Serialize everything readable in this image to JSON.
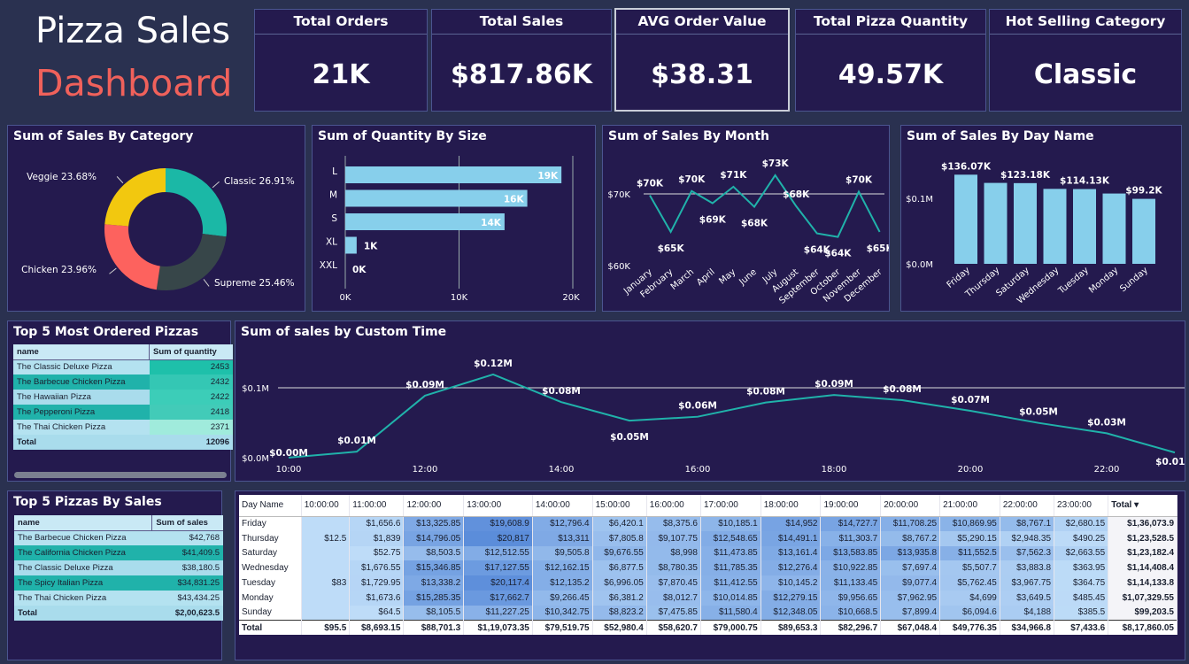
{
  "header": {
    "title_line1": "Pizza Sales",
    "title_line2": "Dashboard"
  },
  "kpis": [
    {
      "label": "Total Orders",
      "value": "21K"
    },
    {
      "label": "Total Sales",
      "value": "$817.86K"
    },
    {
      "label": "AVG Order Value",
      "value": "$38.31"
    },
    {
      "label": "Total Pizza Quantity",
      "value": "49.57K"
    },
    {
      "label": "Hot Selling Category",
      "value": "Classic"
    }
  ],
  "colors": {
    "background": "#2a3150",
    "card": "#241a4e",
    "accent_teal": "#20b2aa",
    "bar_blue": "#87ceeb",
    "red": "#f0615b"
  },
  "chart_data": [
    {
      "type": "pie",
      "title": "Sum of Sales By Category",
      "slices": [
        {
          "name": "Classic",
          "value": 26.91,
          "label": "Classic 26.91%",
          "color": "#1bb8a6"
        },
        {
          "name": "Supreme",
          "value": 25.46,
          "label": "Supreme 25.46%",
          "color": "#374649"
        },
        {
          "name": "Chicken",
          "value": 23.96,
          "label": "Chicken 23.96%",
          "color": "#fd625e"
        },
        {
          "name": "Veggie",
          "value": 23.68,
          "label": "Veggie 23.68%",
          "color": "#f2c80f"
        }
      ]
    },
    {
      "type": "bar",
      "title": "Sum of Quantity By Size",
      "orientation": "horizontal",
      "categories": [
        "L",
        "M",
        "S",
        "XL",
        "XXL"
      ],
      "values": [
        19000,
        16000,
        14000,
        1000,
        0
      ],
      "data_labels": [
        "19K",
        "16K",
        "14K",
        "1K",
        "0K"
      ],
      "ticks": [
        "0K",
        "10K",
        "20K"
      ],
      "xlim": [
        0,
        20000
      ]
    },
    {
      "type": "line",
      "title": "Sum of Sales By Month",
      "categories": [
        "January",
        "February",
        "March",
        "April",
        "May",
        "June",
        "July",
        "August",
        "September",
        "October",
        "November",
        "December"
      ],
      "values": [
        69800,
        64700,
        70400,
        68700,
        71000,
        68200,
        72600,
        68300,
        64500,
        64000,
        70300,
        64700
      ],
      "data_labels": [
        "$70K",
        "$65K",
        "$70K",
        "$69K",
        "$71K",
        "$68K",
        "$73K",
        "$68K",
        "$64K",
        "$64K",
        "$70K",
        "$65K"
      ],
      "yticks": [
        "$60K",
        "$70K"
      ],
      "ylim": [
        60000,
        72500
      ]
    },
    {
      "type": "bar",
      "title": "Sum of Sales By Day Name",
      "categories": [
        "Friday",
        "Thursday",
        "Saturday",
        "Wednesday",
        "Tuesday",
        "Monday",
        "Sunday"
      ],
      "values": [
        136070,
        123530,
        123180,
        114410,
        114130,
        107330,
        99200
      ],
      "data_labels": [
        "$136.07K",
        "",
        "$123.18K",
        "",
        "$114.13K",
        "",
        "$99.2K"
      ],
      "yticks": [
        "$0.0M",
        "$0.1M"
      ],
      "ylim": [
        0,
        150000
      ]
    },
    {
      "type": "line",
      "title": "Sum of sales by Custom Time",
      "x": [
        10,
        11,
        12,
        13,
        14,
        15,
        16,
        17,
        18,
        19,
        20,
        21,
        22,
        23
      ],
      "values": [
        95.5,
        8693.15,
        88701.3,
        119073.35,
        79519.75,
        52980.4,
        58620.7,
        79000.75,
        89653.3,
        82296.7,
        67048.4,
        49776.35,
        34966.8,
        7433.6
      ],
      "data_labels": [
        "$0.00M",
        "$0.01M",
        "$0.09M",
        "$0.12M",
        "$0.08M",
        "$0.05M",
        "$0.06M",
        "$0.08M",
        "$0.09M",
        "$0.08M",
        "$0.07M",
        "$0.05M",
        "$0.03M",
        "$0.01M"
      ],
      "xticks": [
        "10:00",
        "12:00",
        "14:00",
        "16:00",
        "18:00",
        "20:00",
        "22:00"
      ],
      "yticks": [
        "$0.0M",
        "$0.1M"
      ],
      "ylim": [
        0,
        130000
      ]
    }
  ],
  "top5_quantity": {
    "title": "Top 5 Most Ordered Pizzas",
    "headers": [
      "name",
      "Sum of quantity"
    ],
    "rows": [
      [
        "The Classic Deluxe Pizza",
        "2453"
      ],
      [
        "The Barbecue Chicken Pizza",
        "2432"
      ],
      [
        "The Hawaiian Pizza",
        "2422"
      ],
      [
        "The Pepperoni Pizza",
        "2418"
      ],
      [
        "The Thai Chicken Pizza",
        "2371"
      ]
    ],
    "total": [
      "Total",
      "12096"
    ]
  },
  "top5_sales": {
    "title": "Top 5 Pizzas By Sales",
    "headers": [
      "name",
      "Sum of sales"
    ],
    "rows": [
      [
        "The Barbecue Chicken Pizza",
        "$42,768"
      ],
      [
        "The California Chicken Pizza",
        "$41,409.5"
      ],
      [
        "The Classic Deluxe Pizza",
        "$38,180.5"
      ],
      [
        "The Spicy Italian Pizza",
        "$34,831.25"
      ],
      [
        "The Thai Chicken Pizza",
        "$43,434.25"
      ]
    ],
    "total": [
      "Total",
      "$2,00,623.5"
    ]
  },
  "matrix": {
    "headers": [
      "Day Name",
      "10:00:00",
      "11:00:00",
      "12:00:00",
      "13:00:00",
      "14:00:00",
      "15:00:00",
      "16:00:00",
      "17:00:00",
      "18:00:00",
      "19:00:00",
      "20:00:00",
      "21:00:00",
      "22:00:00",
      "23:00:00",
      "Total"
    ],
    "rows": [
      [
        "Friday",
        "",
        "$1,656.6",
        "$13,325.85",
        "$19,608.9",
        "$12,796.4",
        "$6,420.1",
        "$8,375.6",
        "$10,185.1",
        "$14,952",
        "$14,727.7",
        "$11,708.25",
        "$10,869.95",
        "$8,767.1",
        "$2,680.15",
        "$1,36,073.9"
      ],
      [
        "Thursday",
        "$12.5",
        "$1,839",
        "$14,796.05",
        "$20,817",
        "$13,311",
        "$7,805.8",
        "$9,107.75",
        "$12,548.65",
        "$14,491.1",
        "$11,303.7",
        "$8,767.2",
        "$5,290.15",
        "$2,948.35",
        "$490.25",
        "$1,23,528.5"
      ],
      [
        "Saturday",
        "",
        "$52.75",
        "$8,503.5",
        "$12,512.55",
        "$9,505.8",
        "$9,676.55",
        "$8,998",
        "$11,473.85",
        "$13,161.4",
        "$13,583.85",
        "$13,935.8",
        "$11,552.5",
        "$7,562.3",
        "$2,663.55",
        "$1,23,182.4"
      ],
      [
        "Wednesday",
        "",
        "$1,676.55",
        "$15,346.85",
        "$17,127.55",
        "$12,162.15",
        "$6,877.5",
        "$8,780.35",
        "$11,785.35",
        "$12,276.4",
        "$10,922.85",
        "$7,697.4",
        "$5,507.7",
        "$3,883.8",
        "$363.95",
        "$1,14,408.4"
      ],
      [
        "Tuesday",
        "$83",
        "$1,729.95",
        "$13,338.2",
        "$20,117.4",
        "$12,135.2",
        "$6,996.05",
        "$7,870.45",
        "$11,412.55",
        "$10,145.2",
        "$11,133.45",
        "$9,077.4",
        "$5,762.45",
        "$3,967.75",
        "$364.75",
        "$1,14,133.8"
      ],
      [
        "Monday",
        "",
        "$1,673.6",
        "$15,285.35",
        "$17,662.7",
        "$9,266.45",
        "$6,381.2",
        "$8,012.7",
        "$10,014.85",
        "$12,279.15",
        "$9,956.65",
        "$7,962.95",
        "$4,699",
        "$3,649.5",
        "$485.45",
        "$1,07,329.55"
      ],
      [
        "Sunday",
        "",
        "$64.5",
        "$8,105.5",
        "$11,227.25",
        "$10,342.75",
        "$8,823.2",
        "$7,475.85",
        "$11,580.4",
        "$12,348.05",
        "$10,668.5",
        "$7,899.4",
        "$6,094.6",
        "$4,188",
        "$385.5",
        "$99,203.5"
      ]
    ],
    "total": [
      "Total",
      "$95.5",
      "$8,693.15",
      "$88,701.3",
      "$1,19,073.35",
      "$79,519.75",
      "$52,980.4",
      "$58,620.7",
      "$79,000.75",
      "$89,653.3",
      "$82,296.7",
      "$67,048.4",
      "$49,776.35",
      "$34,966.8",
      "$7,433.6",
      "$8,17,860.05"
    ]
  }
}
